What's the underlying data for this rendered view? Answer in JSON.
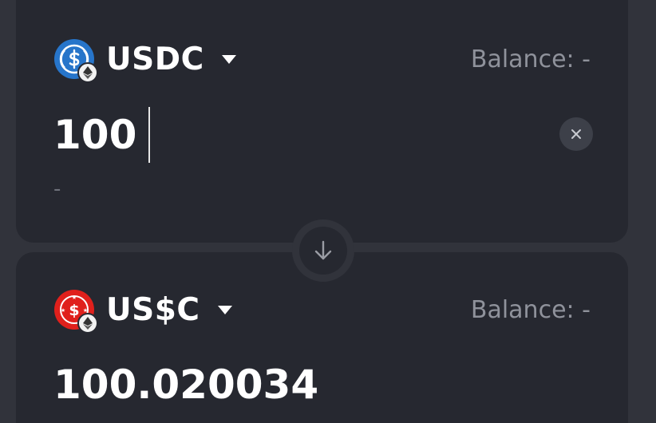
{
  "from": {
    "token_symbol": "USDC",
    "token_icon": "usdc-icon",
    "chain_icon": "ethereum-icon",
    "balance_label": "Balance: -",
    "amount": "100",
    "usd_value": "-",
    "clear_icon": "close-icon"
  },
  "swap": {
    "icon": "arrow-down-icon"
  },
  "to": {
    "token_symbol": "US$C",
    "token_icon": "us-dollar-coin-icon",
    "chain_icon": "ethereum-icon",
    "balance_label": "Balance: -",
    "amount": "100.020034"
  },
  "colors": {
    "background": "#31333b",
    "card": "#262830",
    "usdc_blue": "#2775ca",
    "usc_red": "#e0201c",
    "muted_text": "#8f929b"
  }
}
